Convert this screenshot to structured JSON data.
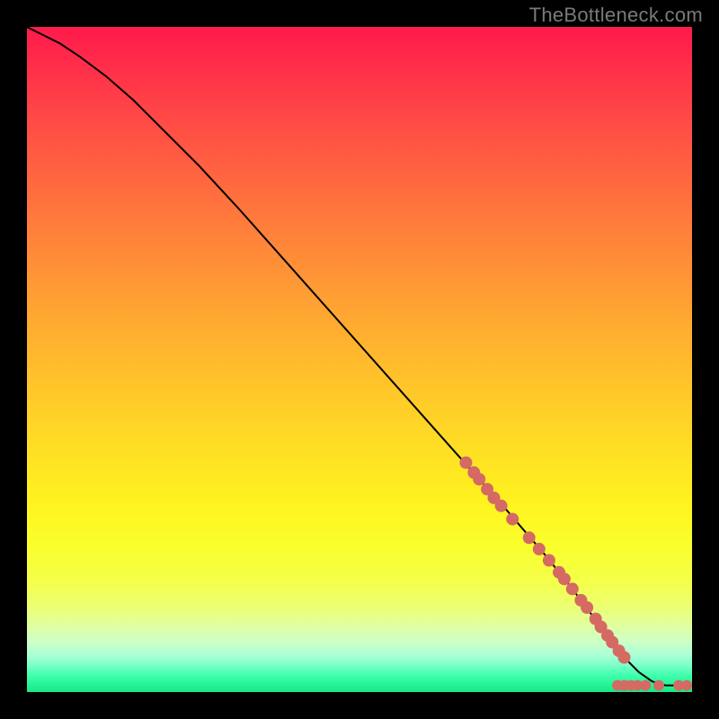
{
  "watermark": "TheBottleneck.com",
  "chart_data": {
    "type": "line",
    "title": "",
    "xlabel": "",
    "ylabel": "",
    "xlim": [
      0,
      100
    ],
    "ylim": [
      0,
      100
    ],
    "grid": false,
    "legend": false,
    "series": [
      {
        "name": "curve",
        "x": [
          0,
          2,
          5,
          8,
          12,
          16,
          20,
          26,
          32,
          40,
          48,
          56,
          64,
          72,
          78,
          82,
          85,
          88,
          90,
          92,
          94,
          96,
          98,
          100
        ],
        "y": [
          100,
          99,
          97.5,
          95.5,
          92.5,
          89,
          85,
          79,
          72.5,
          63.5,
          54.5,
          45.5,
          36.5,
          27.5,
          20.5,
          15.5,
          11.5,
          7.5,
          5,
          3,
          1.6,
          1,
          1,
          1
        ]
      }
    ],
    "points": [
      {
        "x": 66.0,
        "y": 34.5
      },
      {
        "x": 67.2,
        "y": 33.0
      },
      {
        "x": 68.0,
        "y": 32.0
      },
      {
        "x": 69.2,
        "y": 30.5
      },
      {
        "x": 70.2,
        "y": 29.2
      },
      {
        "x": 71.3,
        "y": 28.0
      },
      {
        "x": 73.0,
        "y": 26.0
      },
      {
        "x": 75.5,
        "y": 23.2
      },
      {
        "x": 77.0,
        "y": 21.5
      },
      {
        "x": 78.5,
        "y": 19.8
      },
      {
        "x": 80.0,
        "y": 18.0
      },
      {
        "x": 80.8,
        "y": 17.0
      },
      {
        "x": 82.0,
        "y": 15.5
      },
      {
        "x": 83.3,
        "y": 13.8
      },
      {
        "x": 84.2,
        "y": 12.7
      },
      {
        "x": 85.5,
        "y": 11.0
      },
      {
        "x": 86.3,
        "y": 9.8
      },
      {
        "x": 87.3,
        "y": 8.5
      },
      {
        "x": 88.0,
        "y": 7.5
      },
      {
        "x": 89.0,
        "y": 6.2
      },
      {
        "x": 89.8,
        "y": 5.2
      },
      {
        "x": 88.8,
        "y": 1.0
      },
      {
        "x": 89.8,
        "y": 1.0
      },
      {
        "x": 90.8,
        "y": 1.0
      },
      {
        "x": 91.8,
        "y": 1.0
      },
      {
        "x": 93.0,
        "y": 1.0
      },
      {
        "x": 95.0,
        "y": 1.0
      },
      {
        "x": 98.0,
        "y": 1.0
      },
      {
        "x": 99.2,
        "y": 1.0
      }
    ],
    "point_radius_large": 7,
    "point_radius_small": 6
  }
}
